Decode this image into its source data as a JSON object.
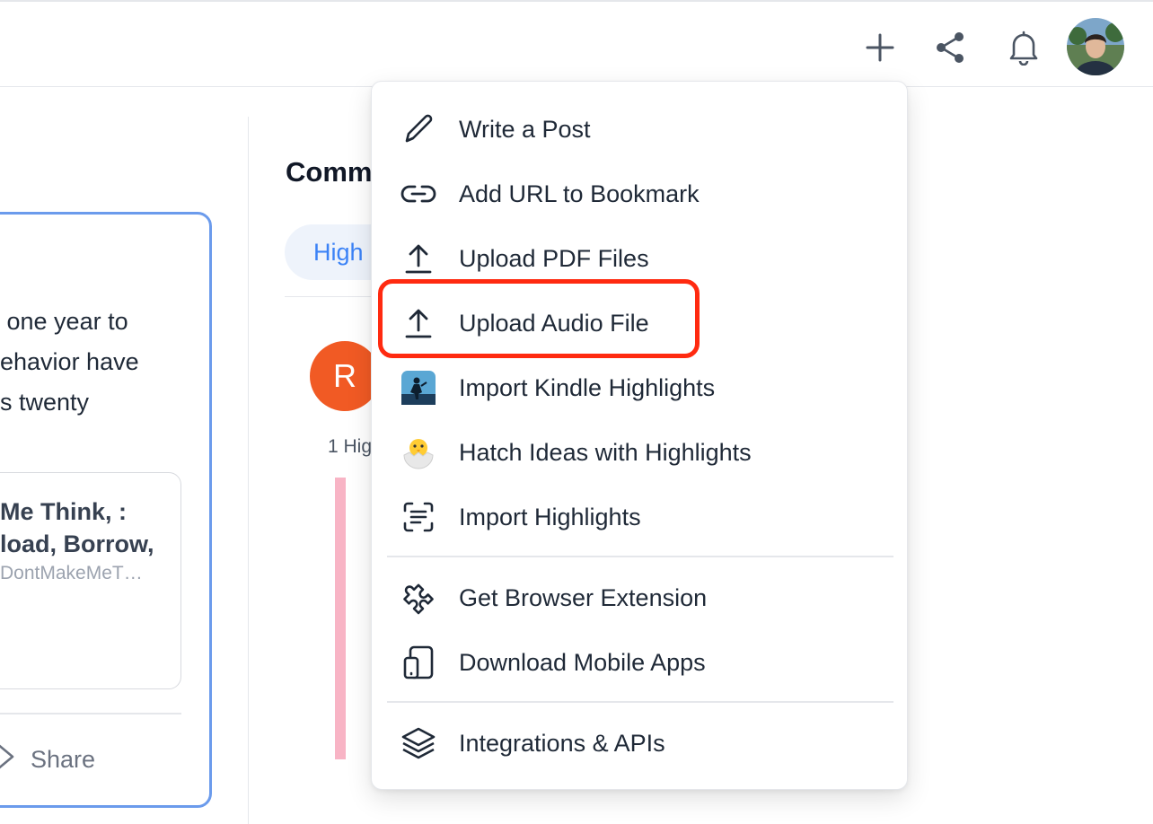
{
  "topbar": {
    "icons": [
      "plus-icon",
      "share-icon",
      "bell-icon"
    ]
  },
  "card": {
    "text_lines": " one year to\nehavior have\ns twenty",
    "link_title": "Me Think, :\nload, Borrow,",
    "link_url": "DontMakeMeT…",
    "share_label": "Share"
  },
  "comments": {
    "title": "Comm",
    "pill_label": "High",
    "avatar_letter": "R",
    "highlight_count": "1 Hig"
  },
  "menu": {
    "items": [
      {
        "label": "Write a Post",
        "icon": "pencil-icon"
      },
      {
        "label": "Add URL to Bookmark",
        "icon": "link-icon"
      },
      {
        "label": "Upload PDF Files",
        "icon": "upload-icon"
      },
      {
        "label": "Upload Audio File",
        "icon": "upload-icon"
      },
      {
        "label": "Import Kindle Highlights",
        "icon": "kindle-icon"
      },
      {
        "label": "Hatch Ideas with Highlights",
        "icon": "hatching-chick-icon"
      },
      {
        "label": "Import Highlights",
        "icon": "scan-text-icon"
      },
      {
        "label": "Get Browser Extension",
        "icon": "puzzle-icon"
      },
      {
        "label": "Download Mobile Apps",
        "icon": "devices-icon"
      },
      {
        "label": "Integrations & APIs",
        "icon": "layers-icon"
      }
    ]
  },
  "colors": {
    "accent": "#3b82f6",
    "highlight_border": "#ff2a10",
    "avatar_orange": "#f15a24",
    "highlight_bar": "#f8b4c5"
  }
}
